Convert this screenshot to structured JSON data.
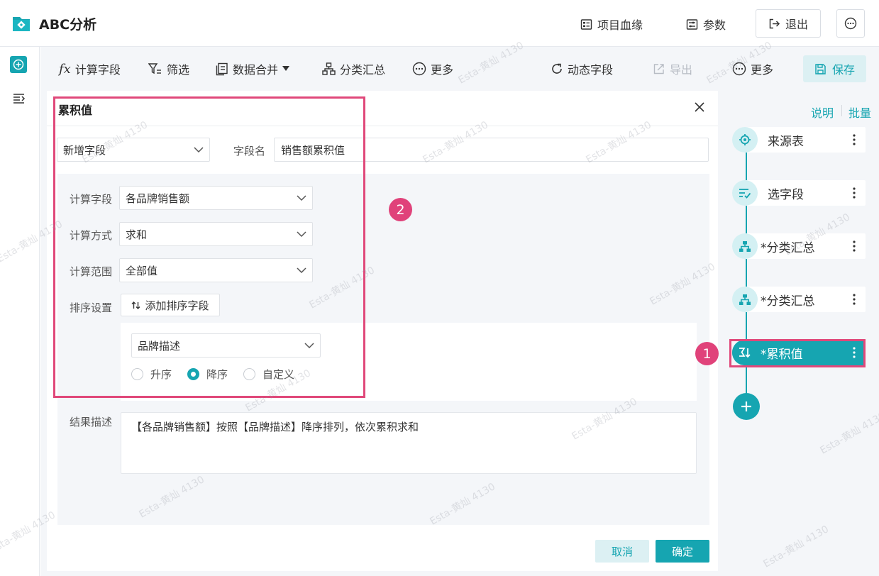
{
  "app": {
    "title": "ABC分析"
  },
  "header": {
    "lineage_label": "项目血缘",
    "params_label": "参数",
    "exit_label": "退出"
  },
  "toolbar": {
    "calc_field": "计算字段",
    "filter": "筛选",
    "merge": "数据合并",
    "group_summary": "分类汇总",
    "more": "更多",
    "dynamic_field": "动态字段",
    "export": "导出",
    "more2": "更多",
    "save": "保存"
  },
  "dialog": {
    "title": "累积值",
    "mode_value": "新增字段",
    "field_name_label": "字段名",
    "field_name_value": "销售额累积值",
    "calc_field_label": "计算字段",
    "calc_field_value": "各品牌销售额",
    "calc_method_label": "计算方式",
    "calc_method_value": "求和",
    "calc_scope_label": "计算范围",
    "calc_scope_value": "全部值",
    "sort_label": "排序设置",
    "add_sort_button": "添加排序字段",
    "sort_field_value": "品牌描述",
    "sort_options": {
      "asc": "升序",
      "desc": "降序",
      "custom": "自定义"
    },
    "sort_selected": "desc",
    "result_label": "结果描述",
    "result_text": "【各品牌销售额】按照【品牌描述】降序排列，依次累积求和",
    "cancel": "取消",
    "confirm": "确定"
  },
  "flow": {
    "explain_link": "说明",
    "batch_link": "批量",
    "nodes": [
      {
        "label": "来源表",
        "icon": "target-icon"
      },
      {
        "label": "选字段",
        "icon": "field-select-icon"
      },
      {
        "label": "*分类汇总",
        "icon": "hierarchy-icon"
      },
      {
        "label": "*分类汇总",
        "icon": "hierarchy-icon"
      },
      {
        "label": "*累积值",
        "icon": "cumulative-icon"
      }
    ]
  },
  "annotations": {
    "badge1": "1",
    "badge2": "2"
  },
  "watermark": "Esta-黄灿 4130",
  "colors": {
    "accent": "#16a5b1",
    "annotation": "#e0427a"
  }
}
